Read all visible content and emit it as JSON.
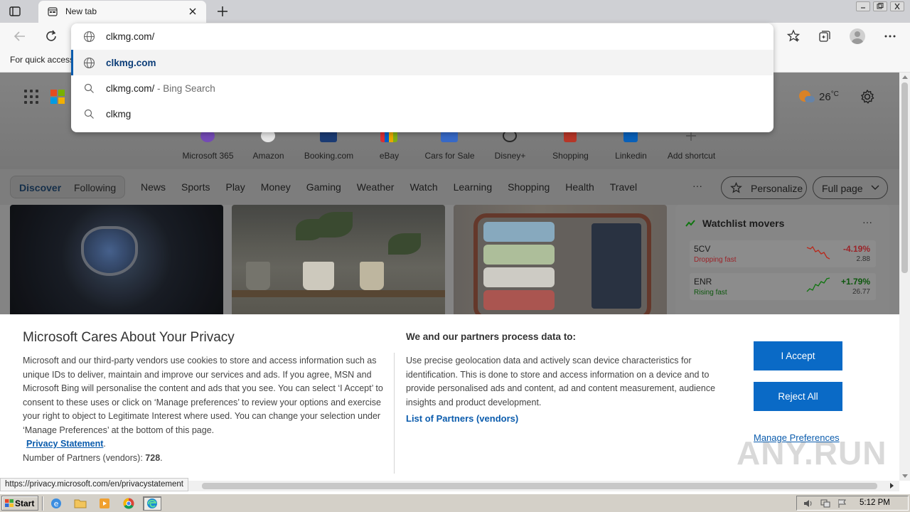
{
  "browser": {
    "tab_title": "New tab",
    "favorites_bar_text": "For quick access"
  },
  "omnibox": {
    "value": "clkmg.com/",
    "suggestions": [
      {
        "main": "clkmg.com",
        "sub": "",
        "icon": "globe-icon"
      },
      {
        "main": "clkmg.com/",
        "sub": " - Bing Search",
        "icon": "search-icon"
      },
      {
        "main": "clkmg",
        "sub": "",
        "icon": "search-icon"
      }
    ]
  },
  "weather": {
    "temp": "26",
    "unit": "°C"
  },
  "shortcuts": [
    {
      "label": "Microsoft 365",
      "color": "#7b4fbf"
    },
    {
      "label": "Amazon",
      "color": "#ffffff"
    },
    {
      "label": "Booking.com",
      "color": "#1d3f7a"
    },
    {
      "label": "eBay",
      "color": "#e53238"
    },
    {
      "label": "Cars for Sale",
      "color": "#3a6fd1"
    },
    {
      "label": "Disney+",
      "color": "#2b2b2b"
    },
    {
      "label": "Shopping",
      "color": "#c0392b"
    },
    {
      "label": "Linkedin",
      "color": "#0a66c2"
    },
    {
      "label": "Add shortcut",
      "color": "#9a9a9a"
    }
  ],
  "feed": {
    "discover": "Discover",
    "following": "Following",
    "nav": [
      "News",
      "Sports",
      "Play",
      "Money",
      "Gaming",
      "Weather",
      "Watch",
      "Learning",
      "Shopping",
      "Health",
      "Travel"
    ],
    "more": "···",
    "personalize": "Personalize",
    "full_page": "Full page"
  },
  "watchlist": {
    "title": "Watchlist movers",
    "more": "···",
    "stocks": [
      {
        "symbol": "5CV",
        "status": "Dropping fast",
        "change": "-4.19%",
        "price": "2.88",
        "color": "#c42b1c"
      },
      {
        "symbol": "ENR",
        "status": "Rising fast",
        "change": "+1.79%",
        "price": "26.77",
        "color": "#107c10"
      }
    ]
  },
  "privacy": {
    "title": "Microsoft Cares About Your Privacy",
    "body": "Microsoft and our third-party vendors use cookies to store and access information such as unique IDs to deliver, maintain and improve our services and ads. If you agree, MSN and Microsoft Bing will personalise the content and ads that you see. You can select ‘I Accept’ to consent to these uses or click on ‘Manage preferences’ to review your options and exercise your right to object to Legitimate Interest where used.  You can change your selection under ‘Manage Preferences’ at the bottom of this page.",
    "statement_link": "Privacy Statement",
    "partners_label": "Number of Partners (vendors): ",
    "partners_count": "728",
    "purpose_title": "We and our partners process data to:",
    "purpose_body": "Use precise geolocation data and actively scan device characteristics for identification. This is done to store and access information on a device and to provide personalised ads and content, ad and content measurement, audience insights and product development.",
    "partners_link": "List of Partners (vendors)",
    "accept": "I Accept",
    "reject": "Reject All",
    "manage": "Manage Preferences"
  },
  "status_url": "https://privacy.microsoft.com/en/privacystatement",
  "watermark": "ANY.RUN",
  "taskbar": {
    "start": "Start",
    "clock": "5:12 PM"
  },
  "colors": {
    "accent": "#0a6ac6",
    "link": "#0b5cad"
  }
}
